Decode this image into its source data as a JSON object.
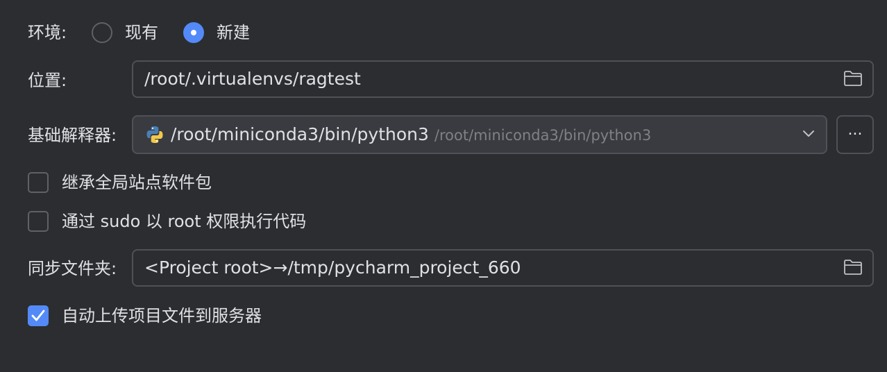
{
  "environment": {
    "label": "环境:",
    "option_existing": "现有",
    "option_new": "新建",
    "selected": "新建"
  },
  "location": {
    "label": "位置:",
    "value": "/root/.virtualenvs/ragtest"
  },
  "base_interpreter": {
    "label": "基础解释器:",
    "value": "/root/miniconda3/bin/python3",
    "hint": "/root/miniconda3/bin/python3",
    "browse_label": "..."
  },
  "inherit_packages": {
    "label": "继承全局站点软件包",
    "checked": false
  },
  "sudo_root": {
    "label": "通过 sudo 以 root 权限执行代码",
    "checked": false
  },
  "sync_folder": {
    "label": "同步文件夹:",
    "value": "<Project root>→/tmp/pycharm_project_660"
  },
  "auto_upload": {
    "label": "自动上传项目文件到服务器",
    "checked": true
  },
  "colors": {
    "background": "#2b2d30",
    "accent": "#548af7",
    "border": "#4e5157",
    "text": "#dfe1e5",
    "hint_text": "#7e8187"
  }
}
